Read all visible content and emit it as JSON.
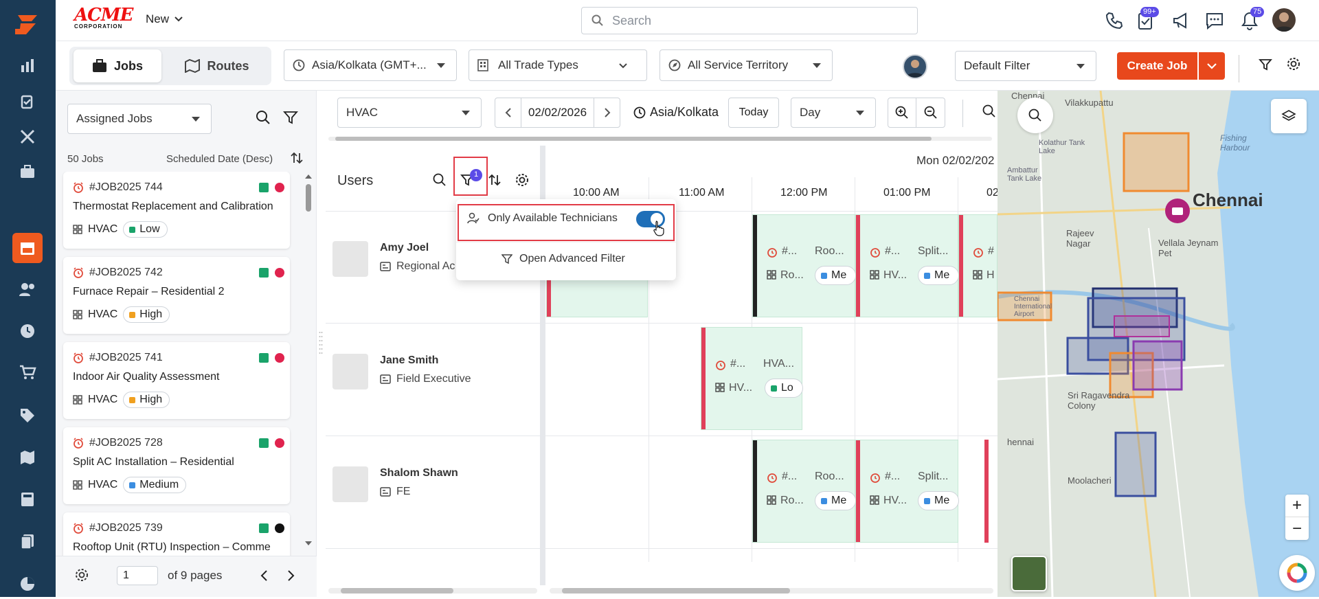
{
  "brand": {
    "logo_text": "ACME",
    "logo_sub": "CORPORATION"
  },
  "header": {
    "new_label": "New",
    "search_placeholder": "Search",
    "tasks_badge": "99+",
    "notifications_badge": "75"
  },
  "toolbar": {
    "tab_jobs": "Jobs",
    "tab_routes": "Routes",
    "timezone": "Asia/Kolkata (GMT+...",
    "trade_types": "All Trade Types",
    "territory": "All Service Territory",
    "filter_select": "Default Filter",
    "create_job": "Create Job"
  },
  "job_list": {
    "filter": "Assigned Jobs",
    "count": "50 Jobs",
    "sort": "Scheduled Date (Desc)",
    "jobs": [
      {
        "id": "#JOB2025 744",
        "title": "Thermostat Replacement and Calibration",
        "trade": "HVAC",
        "priority": "Low",
        "priority_color": "#1aa36a",
        "status_color": "#e0234e"
      },
      {
        "id": "#JOB2025 742",
        "title": "Furnace Repair – Residential 2",
        "trade": "HVAC",
        "priority": "High",
        "priority_color": "#f0a020",
        "status_color": "#e0234e"
      },
      {
        "id": "#JOB2025 741",
        "title": "Indoor Air Quality Assessment",
        "trade": "HVAC",
        "priority": "High",
        "priority_color": "#f0a020",
        "status_color": "#e0234e"
      },
      {
        "id": "#JOB2025 728",
        "title": "Split AC Installation – Residential",
        "trade": "HVAC",
        "priority": "Medium",
        "priority_color": "#3b8de0",
        "status_color": "#e0234e"
      },
      {
        "id": "#JOB2025 739",
        "title": "Rooftop Unit (RTU) Inspection – Comme",
        "trade": "HVAC",
        "priority": "",
        "priority_color": "#1aa36a",
        "status_color": "#111111"
      }
    ],
    "page": "1",
    "pages_label": "of 9 pages"
  },
  "schedule": {
    "trade": "HVAC",
    "date": "02/02/2026",
    "timezone": "Asia/Kolkata",
    "today": "Today",
    "view": "Day",
    "day_header": "Mon 02/02/202",
    "users_label": "Users",
    "filter_badge": "1",
    "times": [
      "10:00 AM",
      "11:00 AM",
      "12:00 PM",
      "01:00 PM",
      "02"
    ],
    "users": [
      {
        "name": "Amy Joel",
        "role": "Regional Ac"
      },
      {
        "name": "Jane Smith",
        "role": "Field Executive"
      },
      {
        "name": "Shalom Shawn",
        "role": "FE"
      }
    ],
    "events": [
      {
        "id": "#...",
        "title": "Roo...",
        "line2": "Ro...",
        "pill": "Me"
      },
      {
        "id": "#...",
        "title": "Split...",
        "line2": "HV...",
        "pill": "Me"
      },
      {
        "id": "#",
        "title": "",
        "line2": "H",
        "pill": ""
      },
      {
        "id": "#...",
        "title": "HVA...",
        "line2": "HV...",
        "pill": "Lo"
      },
      {
        "id": "#...",
        "title": "Roo...",
        "line2": "Ro...",
        "pill": "Me"
      },
      {
        "id": "#...",
        "title": "Split...",
        "line2": "HV...",
        "pill": "Me"
      }
    ]
  },
  "popup": {
    "toggle_label": "Only Available Technicians",
    "advanced": "Open Advanced Filter"
  },
  "map": {
    "labels": [
      "Chennai",
      "Vilakkupattu",
      "Fishing Harbour",
      "Kolathur Tank Lake",
      "Ambattur Tank Lake",
      "Chennai",
      "Rajeev Nagar",
      "Vellala Jeynam Pet",
      "Chennai International Airport",
      "Sri Ragavendra Colony",
      "hennai",
      "Moolacheri"
    ]
  }
}
